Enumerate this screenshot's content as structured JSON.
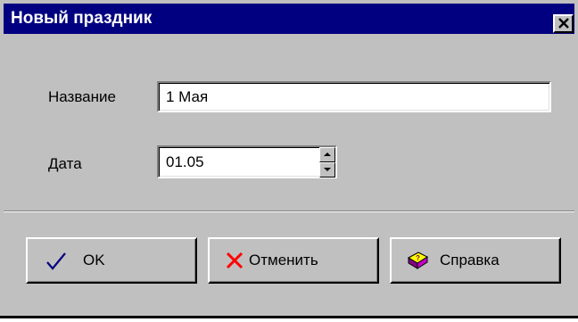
{
  "window": {
    "title": "Новый праздник",
    "colors": {
      "face": "#c0c0c0",
      "titlebar": "#000080",
      "title_text": "#ffffff"
    }
  },
  "form": {
    "name_label": "Название",
    "name_value": "1 Мая",
    "date_label": "Дата",
    "date_value": "01.05"
  },
  "buttons": {
    "ok": {
      "label": "OK",
      "icon": "checkmark-icon",
      "icon_color": "#000080"
    },
    "cancel": {
      "label": "Отменить",
      "icon": "cross-icon",
      "icon_color": "#ff0000"
    },
    "help": {
      "label": "Справка",
      "icon": "help-book-icon",
      "icon_color": "#800080"
    }
  }
}
